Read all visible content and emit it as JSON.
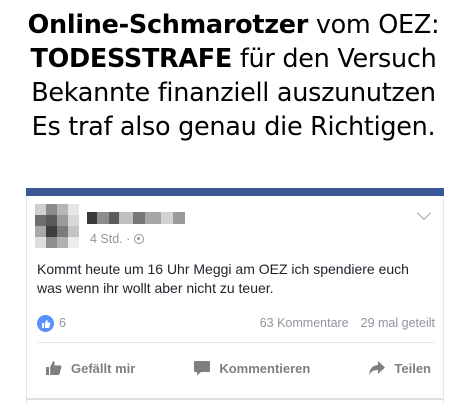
{
  "headline": {
    "line1_bold": "Online-Schmarotzer",
    "line1_rest": " vom OEZ:",
    "line2_bold": "TODESSTRAFE",
    "line2_rest": " für den Versuch",
    "line3": "Bekannte finanziell auszunutzen",
    "line4": "Es traf also genau die Richtigen."
  },
  "post": {
    "time": "4 Std. ·",
    "text": "Kommt heute um 16 Uhr Meggi am OEZ ich spendiere euch was wenn ihr wollt aber nicht zu teuer.",
    "like_count": "6",
    "comments": "63 Kommentare",
    "shares": "29 mal geteilt"
  },
  "actions": {
    "like": "Gefällt mir",
    "comment": "Kommentieren",
    "share": "Teilen"
  },
  "colors": {
    "facebook_blue": "#3b5998",
    "like_blue": "#5890ff",
    "meta_gray": "#90949c"
  },
  "icons": [
    "globe-icon",
    "chevron-down-icon",
    "like-reaction-icon",
    "thumbs-up-icon",
    "comment-icon",
    "share-icon"
  ]
}
